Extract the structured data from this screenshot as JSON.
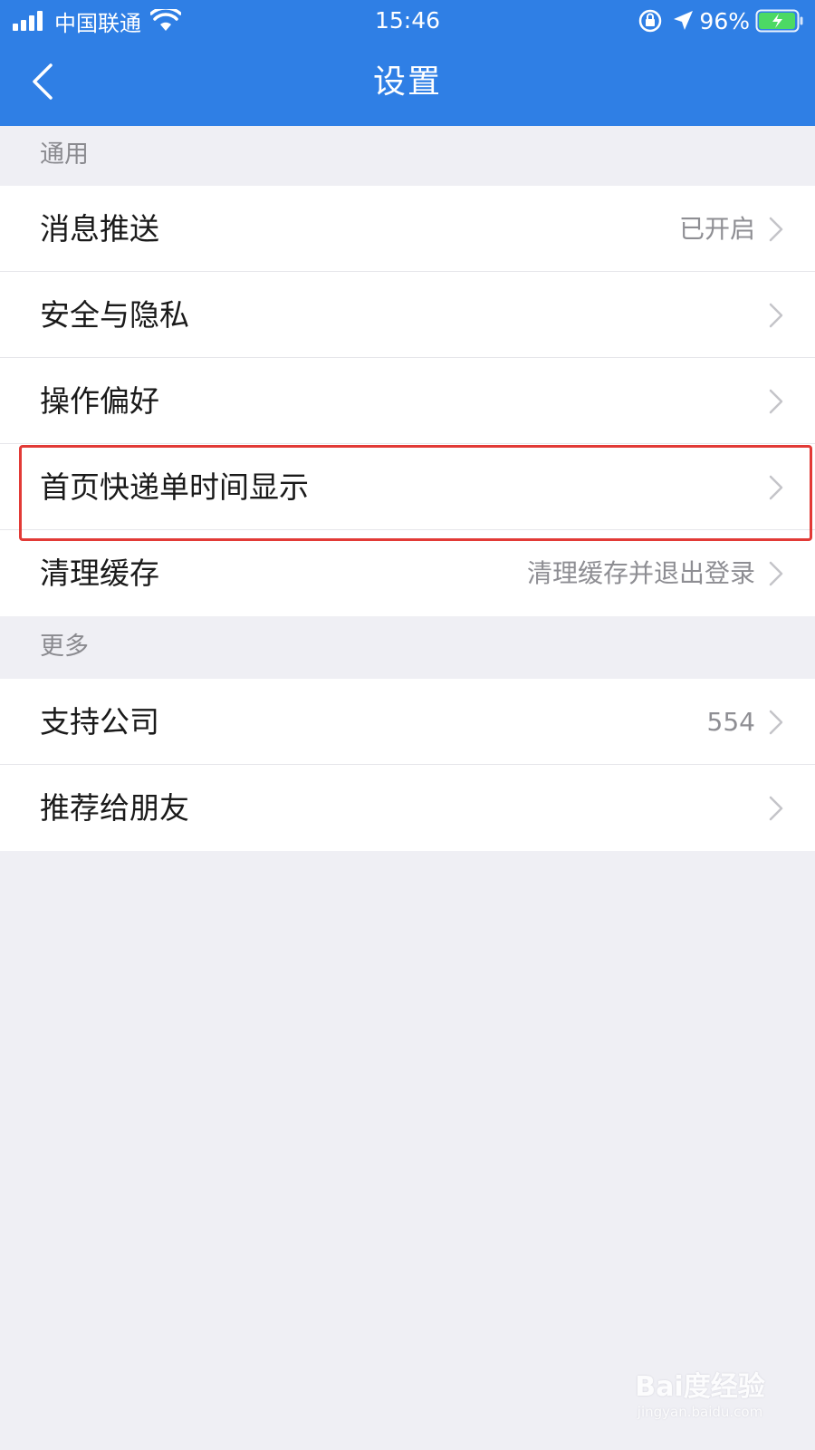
{
  "status_bar": {
    "carrier": "中国联通",
    "time": "15:46",
    "battery": "96%"
  },
  "nav": {
    "title": "设置"
  },
  "sections": {
    "general": {
      "label": "通用",
      "items": [
        {
          "label": "消息推送",
          "value": "已开启"
        },
        {
          "label": "安全与隐私",
          "value": ""
        },
        {
          "label": "操作偏好",
          "value": ""
        },
        {
          "label": "首页快递单时间显示",
          "value": ""
        },
        {
          "label": "清理缓存",
          "value": "清理缓存并退出登录"
        }
      ]
    },
    "more": {
      "label": "更多",
      "items": [
        {
          "label": "支持公司",
          "value": "554"
        },
        {
          "label": "推荐给朋友",
          "value": ""
        }
      ]
    }
  },
  "watermark": {
    "logo": "Bai度经验",
    "url": "jingyan.baidu.com"
  },
  "colors": {
    "header": "#2f7fe5",
    "highlight_box": "#e23a36",
    "background": "#efeff4"
  }
}
